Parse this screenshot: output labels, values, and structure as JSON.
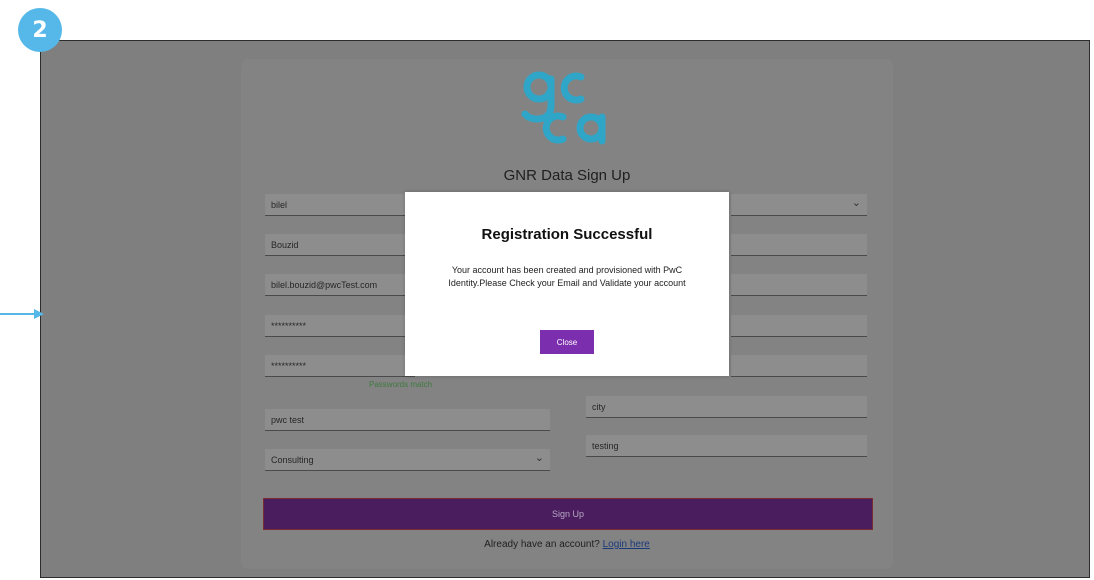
{
  "step": "2",
  "app": {
    "title": "GNR Data Sign Up"
  },
  "form": {
    "first_name": "bilel",
    "last_name": "Bouzid",
    "email": "bilel.bouzid@pwcTest.com",
    "password": "**********",
    "confirm_password": "**********",
    "password_match": "Passwords match",
    "company": "pwc test",
    "industry": "Consulting",
    "right_field_1": "",
    "right_field_2": "",
    "right_field_3": "",
    "right_field_4": "",
    "right_field_5": "",
    "city": "city",
    "right_field_7": "testing"
  },
  "signup_button": "Sign Up",
  "login_prompt": "Already have an account?",
  "login_link": "Login here",
  "modal": {
    "title": "Registration Successful",
    "message": "Your account has been created and provisioned with PwC Identity.Please Check your Email and Validate your account",
    "close_label": "Close"
  },
  "colors": {
    "badge": "#56b8e8",
    "logo": "#2fa6c8",
    "signup_button": "#4a1d5e",
    "close_button": "#7b2eae"
  }
}
